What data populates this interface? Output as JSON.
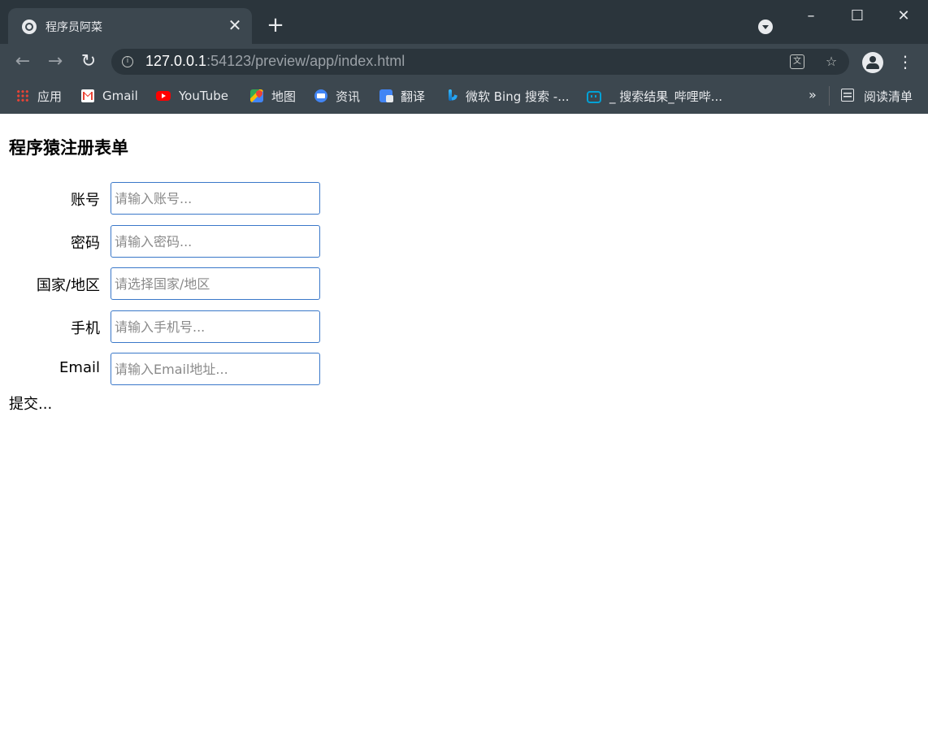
{
  "browser": {
    "tab_title": "程序员阿菜",
    "url_host": "127.0.0.1",
    "url_rest": ":54123/preview/app/index.html",
    "bookmarks": [
      {
        "label": "应用",
        "icon": "apps-grid-icon"
      },
      {
        "label": "Gmail",
        "icon": "gmail-icon"
      },
      {
        "label": "YouTube",
        "icon": "youtube-icon"
      },
      {
        "label": "地图",
        "icon": "maps-icon"
      },
      {
        "label": "资讯",
        "icon": "news-icon"
      },
      {
        "label": "翻译",
        "icon": "translate-icon"
      },
      {
        "label": "微软 Bing 搜索 -...",
        "icon": "bing-icon"
      },
      {
        "label": "_ 搜索结果_哔哩哔...",
        "icon": "bilibili-icon"
      }
    ],
    "overflow_label": "»",
    "reading_list_label": "阅读清单"
  },
  "page": {
    "title": "程序猿注册表单",
    "fields": [
      {
        "label": "账号",
        "placeholder": "请输入账号..."
      },
      {
        "label": "密码",
        "placeholder": "请输入密码..."
      },
      {
        "label": "国家/地区",
        "placeholder": "请选择国家/地区"
      },
      {
        "label": "手机",
        "placeholder": "请输入手机号..."
      },
      {
        "label": "Email",
        "placeholder": "请输入Email地址..."
      }
    ],
    "submit_label": "提交..."
  },
  "colors": {
    "titlebar": "#2b353c",
    "toolbar": "#3c474f",
    "input_border": "#3a78c9"
  }
}
